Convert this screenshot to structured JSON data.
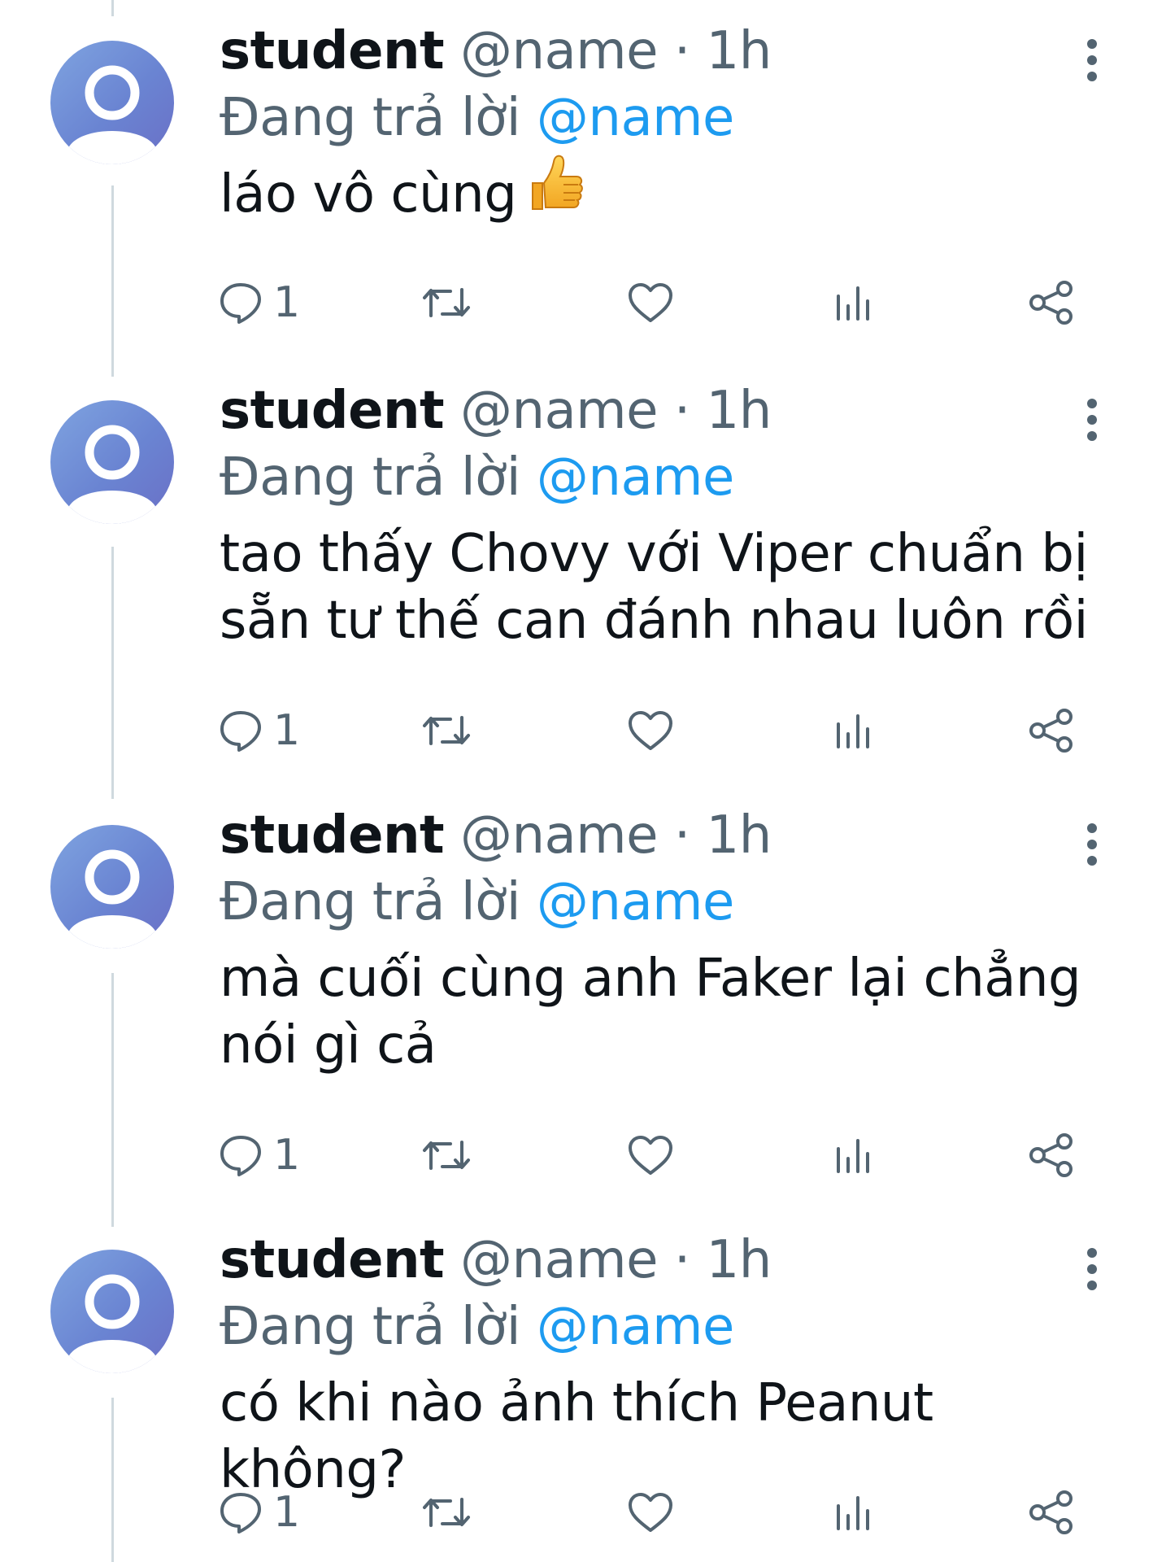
{
  "tweets": [
    {
      "display_name": "student",
      "handle": "@name",
      "separator": "·",
      "time": "1h",
      "reply_prefix": "Đang trả lời",
      "reply_mention": "@name",
      "text_lines": [
        "láo vô cùng"
      ],
      "emoji": "thumbs-up",
      "reply_count": "1"
    },
    {
      "display_name": "student",
      "handle": "@name",
      "separator": "·",
      "time": "1h",
      "reply_prefix": "Đang trả lời",
      "reply_mention": "@name",
      "text_lines": [
        "tao thấy Chovy với Viper chuẩn bị",
        "sẵn tư thế can đánh nhau luôn rồi"
      ],
      "reply_count": "1"
    },
    {
      "display_name": "student",
      "handle": "@name",
      "separator": "·",
      "time": "1h",
      "reply_prefix": "Đang trả lời",
      "reply_mention": "@name",
      "text_lines": [
        "mà cuối cùng anh Faker lại chẳng",
        "nói gì cả"
      ],
      "reply_count": "1"
    },
    {
      "display_name": "student",
      "handle": "@name",
      "separator": "·",
      "time": "1h",
      "reply_prefix": "Đang trả lời",
      "reply_mention": "@name",
      "text_lines": [
        "có khi nào ảnh thích Peanut không?"
      ],
      "reply_count": "1"
    }
  ],
  "icons": {
    "more": "more-vertical-icon",
    "reply": "reply-bubble-icon",
    "retweet": "retweet-icon",
    "like": "heart-icon",
    "views": "views-bars-icon",
    "share": "share-icon"
  },
  "colors": {
    "mention": "#1d9bf0",
    "secondary_text": "#536471",
    "primary_text": "#0f1419",
    "thread_line": "#cfd9de",
    "avatar": "#6a84d2"
  }
}
